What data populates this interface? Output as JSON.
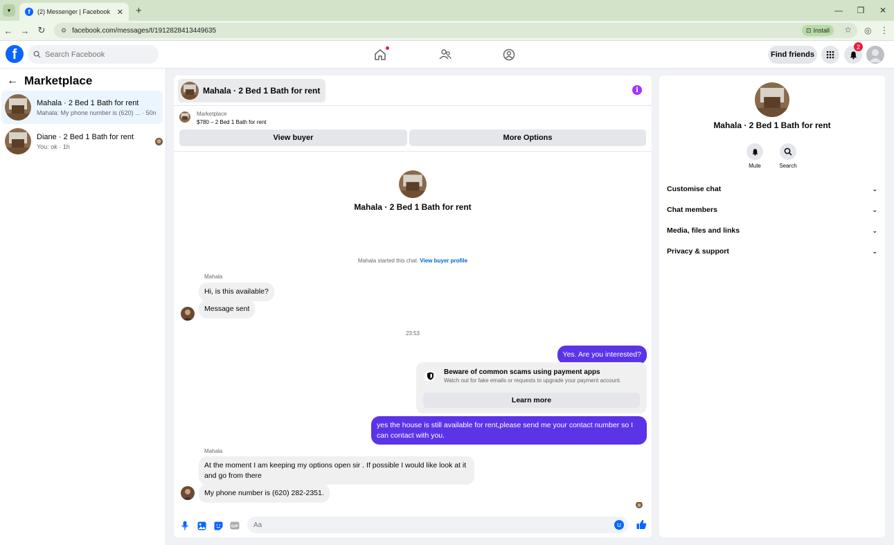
{
  "browser": {
    "tab_title": "(2) Messenger | Facebook",
    "url": "facebook.com/messages/t/1912828413449635",
    "install_label": "Install"
  },
  "header": {
    "search_placeholder": "Search Facebook",
    "find_friends": "Find friends",
    "notification_count": "2"
  },
  "sidebar": {
    "title": "Marketplace",
    "conversations": [
      {
        "name": "Mahala · 2 Bed 1 Bath for rent",
        "snippet": "Mahala: My phone number is (620) ... · 50m"
      },
      {
        "name": "Diane · 2 Bed 1 Bath for rent",
        "snippet": "You: ok · 1h"
      }
    ]
  },
  "chat": {
    "title": "Mahala · 2 Bed 1 Bath for rent",
    "listing_label": "Marketplace",
    "listing_price": "$780 – 2 Bed 1 Bath for rent",
    "view_buyer": "View buyer",
    "more_options": "More Options",
    "hero_name": "Mahala · 2 Bed 1 Bath for rent",
    "started_text": "Mahala started this chat.",
    "view_buyer_profile": "View buyer profile",
    "sender_name": "Mahala",
    "msg1": "Hi, is this available?",
    "msg2": "Message sent",
    "timestamp": "23:53",
    "out1": "Yes. Are you interested?",
    "warn_title": "Beware of common scams using payment apps",
    "warn_sub": "Watch out for fake emails or requests to upgrade your payment account.",
    "learn_more": "Learn more",
    "out2": "yes the house is still available for rent,please send me your contact number so I can contact with you.",
    "sender_name2": "Mahala",
    "msg3": "At the moment I am keeping my options open sir . If possible I would like look at it and go from there",
    "msg4": "My phone number is (620) 282-2351.",
    "composer_placeholder": "Aa"
  },
  "rightpanel": {
    "name": "Mahala · 2 Bed 1 Bath for rent",
    "mute": "Mute",
    "search": "Search",
    "rows": [
      "Customise chat",
      "Chat members",
      "Media, files and links",
      "Privacy & support"
    ]
  },
  "colors": {
    "accent": "#0866ff",
    "outgoing_bubble": "#5b34e8",
    "info": "#a033ff",
    "notification": "#e41e3f"
  }
}
